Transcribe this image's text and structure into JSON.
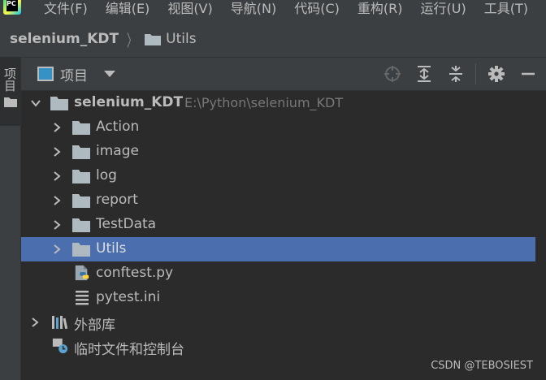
{
  "menu": {
    "logo_text": "PC",
    "items": [
      "文件(F)",
      "编辑(E)",
      "视图(V)",
      "导航(N)",
      "代码(C)",
      "重构(R)",
      "运行(U)",
      "工具(T)"
    ]
  },
  "breadcrumb": {
    "project": "selenium_KDT",
    "folder": "Utils"
  },
  "toolstrip": {
    "tab_label": "项目"
  },
  "panel": {
    "title": "项目"
  },
  "tree": {
    "root": {
      "name": "selenium_KDT",
      "path": "E:\\Python\\selenium_KDT"
    },
    "folders": [
      "Action",
      "image",
      "log",
      "report",
      "TestData",
      "Utils"
    ],
    "selected": "Utils",
    "files": [
      "conftest.py",
      "pytest.ini"
    ],
    "external_libs": "外部库",
    "scratches": "临时文件和控制台"
  },
  "watermark": "CSDN @TEBOSIEST",
  "colors": {
    "background": "#2b2b2b",
    "chrome": "#3c3f41",
    "selection": "#4b6eaf",
    "text": "#bbbbbb",
    "path_text": "#787878",
    "folder_icon": "#aeb9c0"
  },
  "icons": {
    "locate": "crosshair-icon",
    "expand_all": "expand-all-icon",
    "collapse_all": "collapse-all-icon",
    "settings": "gear-icon",
    "hide": "minimize-icon"
  }
}
